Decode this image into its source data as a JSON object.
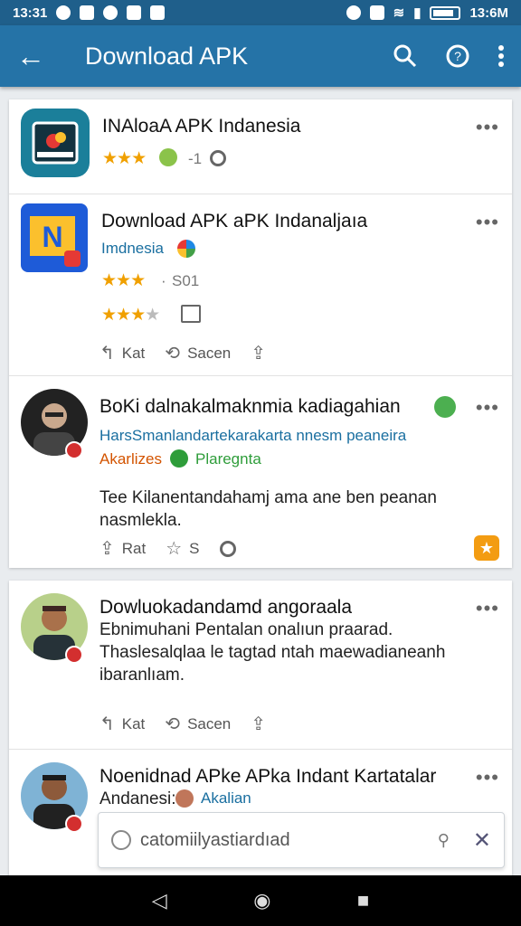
{
  "status_bar": {
    "time_left": "13:31",
    "time_right": "13:6M"
  },
  "app_bar": {
    "title": "Download APK"
  },
  "items": [
    {
      "title": "INAloaA APK Indanesia",
      "rating_suffix": "-1"
    },
    {
      "title": "Download APK aPK Indanaljaıa",
      "subtitle": "Imdnesia",
      "rating_text": "S01",
      "actions": [
        "Kat",
        "Sacen"
      ]
    },
    {
      "title": "BoKi dalnakalmaknmia kadiagahian",
      "line1": "HarsSmanlandartekarakarta nnesm peaneira",
      "tag1": "Akarlizes",
      "tag2": "Plaregnta",
      "body": "Tee Kilanentandahamj ama ane ben peanan nasmlekla.",
      "actions": [
        "Rat",
        "S"
      ]
    },
    {
      "title": "Dowluokadandamd angoraala",
      "body": "Ebnimuhani Pentalan onalıun praarad. Thaslesalqlaa le tagtad ntah maewadianeanh ibaranlıam.",
      "actions": [
        "Kat",
        "Sacen"
      ]
    },
    {
      "title": "Noenidnad APke APka Indant Kartatalar",
      "subtitle": "Andanesi:",
      "tag": "Akalian"
    }
  ],
  "search": {
    "value": "catomiilyastiardıad"
  },
  "colors": {
    "app_bar": "#2573a7",
    "status_bar": "#1f5f8b",
    "star": "#f0a000",
    "link": "#1a6fa0",
    "green": "#2e9d3a"
  }
}
